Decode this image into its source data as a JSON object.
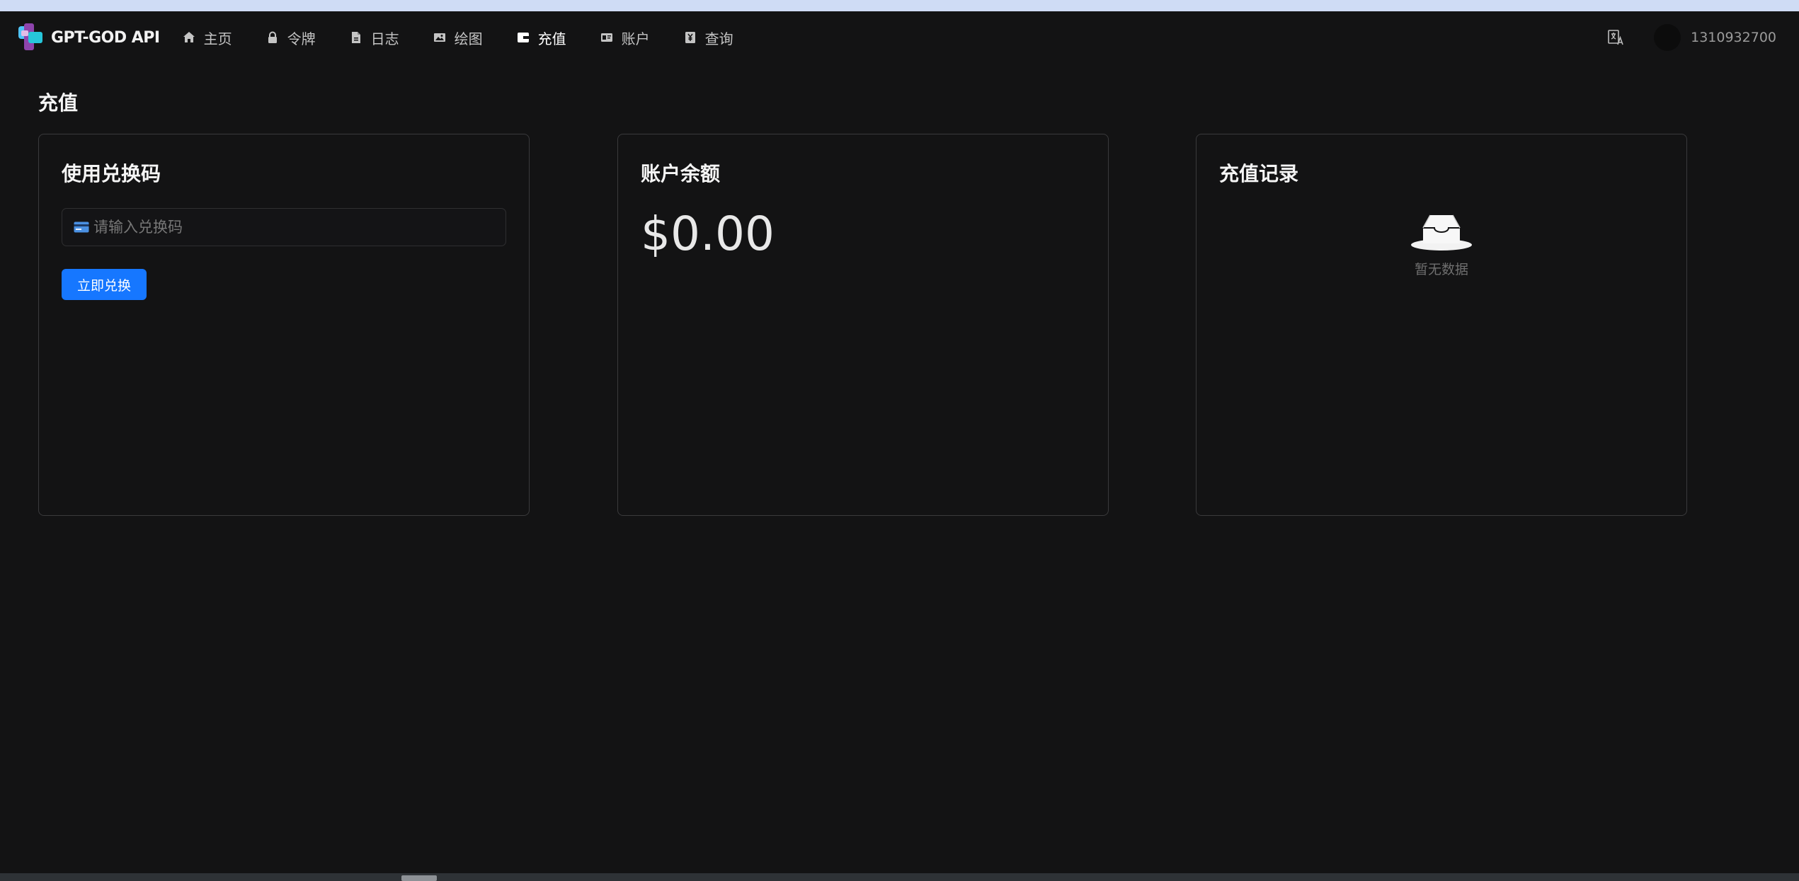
{
  "brand": {
    "name": "GPT-GOD API"
  },
  "nav": {
    "items": [
      {
        "label": "主页",
        "icon": "home-icon"
      },
      {
        "label": "令牌",
        "icon": "lock-icon"
      },
      {
        "label": "日志",
        "icon": "file-icon"
      },
      {
        "label": "绘图",
        "icon": "image-icon"
      },
      {
        "label": "充值",
        "icon": "wallet-icon",
        "active": true
      },
      {
        "label": "账户",
        "icon": "id-card-icon"
      },
      {
        "label": "查询",
        "icon": "yen-icon"
      }
    ]
  },
  "header_right": {
    "language_icon": "translate-icon",
    "username": "1310932700"
  },
  "page": {
    "title": "充值"
  },
  "redeem_card": {
    "title": "使用兑换码",
    "input_placeholder": "请输入兑换码",
    "input_value": "",
    "button_label": "立即兑换"
  },
  "balance_card": {
    "title": "账户余额",
    "amount": "$0.00"
  },
  "history_card": {
    "title": "充值记录",
    "empty_text": "暂无数据"
  },
  "colors": {
    "accent": "#1677ff",
    "background": "#131314",
    "border": "#3a3a3c"
  }
}
